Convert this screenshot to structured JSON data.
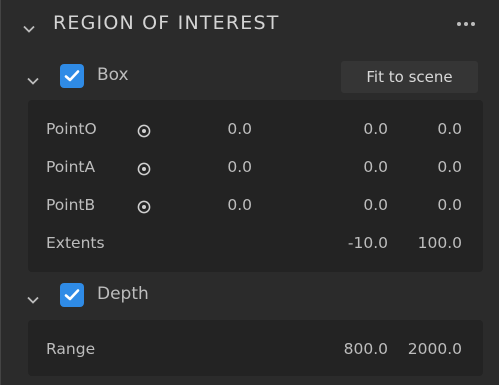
{
  "header": {
    "title": "REGION OF INTEREST"
  },
  "box_section": {
    "label": "Box",
    "checked": true,
    "fit_button": "Fit to scene",
    "rows": [
      {
        "label": "PointO",
        "values": [
          "0.0",
          "0.0",
          "0.0"
        ]
      },
      {
        "label": "PointA",
        "values": [
          "0.0",
          "0.0",
          "0.0"
        ]
      },
      {
        "label": "PointB",
        "values": [
          "0.0",
          "0.0",
          "0.0"
        ]
      }
    ],
    "extents": {
      "label": "Extents",
      "values": [
        "-10.0",
        "100.0"
      ]
    }
  },
  "depth_section": {
    "label": "Depth",
    "checked": true,
    "range": {
      "label": "Range",
      "values": [
        "800.0",
        "2000.0"
      ]
    }
  },
  "colors": {
    "accent": "#2f8be6",
    "panel_bg": "#2b2b2b",
    "card_bg": "#232323"
  },
  "icons": [
    "chevron-down-icon",
    "more-dots-icon",
    "checkmark-icon",
    "target-icon"
  ]
}
